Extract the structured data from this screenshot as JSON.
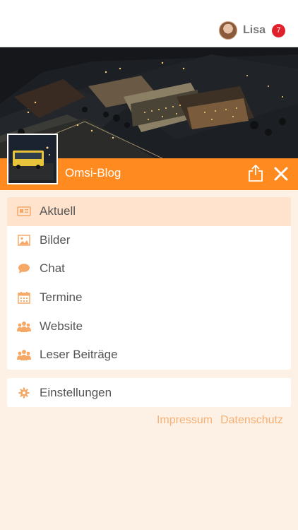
{
  "user": {
    "name": "Lisa",
    "notifications": "7"
  },
  "blog": {
    "title": "Omsi-Blog"
  },
  "menu": {
    "items": [
      {
        "label": "Aktuell",
        "icon": "newspaper-icon",
        "active": true
      },
      {
        "label": "Bilder",
        "icon": "image-icon"
      },
      {
        "label": "Chat",
        "icon": "chat-bubble-icon"
      },
      {
        "label": "Termine",
        "icon": "calendar-icon"
      },
      {
        "label": "Website",
        "icon": "users-icon"
      },
      {
        "label": "Leser Beiträge",
        "icon": "users-icon"
      }
    ],
    "settings": {
      "label": "Einstellungen",
      "icon": "gear-icon"
    }
  },
  "footer": {
    "impressum": "Impressum",
    "datenschutz": "Datenschutz"
  },
  "colors": {
    "accent": "#ff8a1f",
    "icon": "#f6a866",
    "active_bg": "#ffe3cc",
    "background": "#fdf1e6",
    "badge": "#e0212b"
  }
}
